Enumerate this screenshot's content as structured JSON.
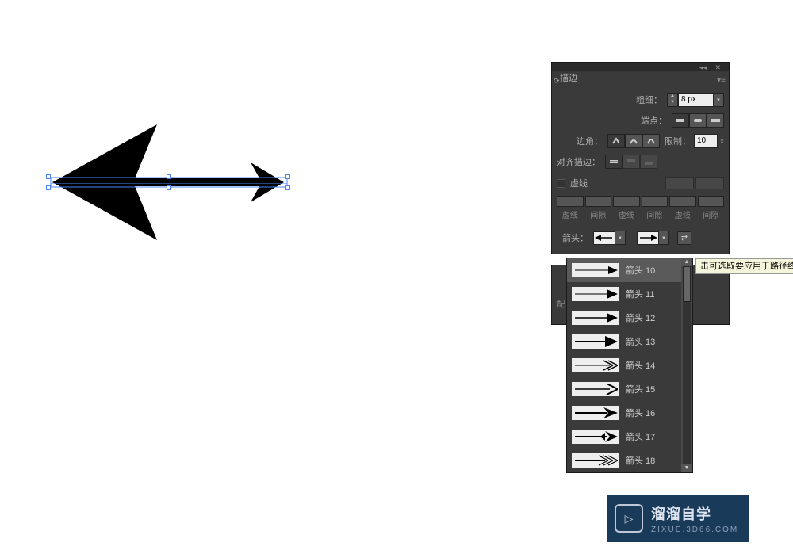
{
  "panel": {
    "title": "描边",
    "weight": {
      "label": "粗细：",
      "value": "8 px"
    },
    "cap": {
      "label": "端点："
    },
    "corner": {
      "label": "边角：",
      "limit_label": "限制：",
      "limit_value": "10",
      "limit_unit": "x"
    },
    "align": {
      "label": "对齐描边："
    },
    "dash": {
      "label": "虚线",
      "cols": [
        "虚线",
        "间隙",
        "虚线",
        "间隙",
        "虚线",
        "间隙"
      ]
    },
    "arrowheads": {
      "label": "箭头："
    },
    "scale": {
      "label": "配"
    }
  },
  "dropdown": {
    "items": [
      {
        "label": "箭头 10"
      },
      {
        "label": "箭头 11"
      },
      {
        "label": "箭头 12"
      },
      {
        "label": "箭头 13"
      },
      {
        "label": "箭头 14"
      },
      {
        "label": "箭头 15"
      },
      {
        "label": "箭头 16"
      },
      {
        "label": "箭头 17"
      },
      {
        "label": "箭头 18"
      }
    ]
  },
  "tooltip": "击可选取要应用于路径终",
  "watermark": {
    "title": "溜溜自学",
    "url": "ZIXUE.3D66.COM"
  }
}
